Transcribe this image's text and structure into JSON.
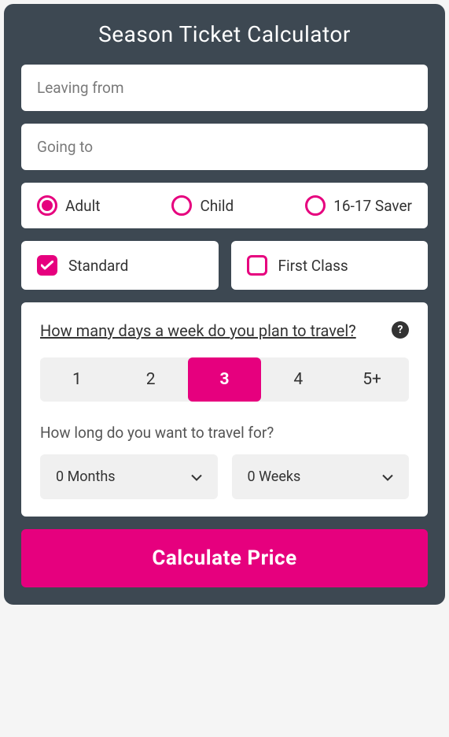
{
  "title": "Season Ticket Calculator",
  "inputs": {
    "leaving_from": {
      "placeholder": "Leaving from",
      "value": ""
    },
    "going_to": {
      "placeholder": "Going to",
      "value": ""
    }
  },
  "passenger_types": {
    "options": [
      {
        "id": "adult",
        "label": "Adult",
        "selected": true
      },
      {
        "id": "child",
        "label": "Child",
        "selected": false
      },
      {
        "id": "saver",
        "label": "16-17 Saver",
        "selected": false
      }
    ]
  },
  "class_options": [
    {
      "id": "standard",
      "label": "Standard",
      "checked": true
    },
    {
      "id": "first",
      "label": "First Class",
      "checked": false
    }
  ],
  "days_section": {
    "question": "How many days a week do you plan to travel?",
    "options": [
      "1",
      "2",
      "3",
      "4",
      "5+"
    ],
    "selected_index": 2
  },
  "duration": {
    "label": "How long do you want to travel for?",
    "months": {
      "value": "0 Months"
    },
    "weeks": {
      "value": "0 Weeks"
    }
  },
  "submit_label": "Calculate Price",
  "colors": {
    "accent": "#e6007e",
    "background": "#3d4852"
  }
}
